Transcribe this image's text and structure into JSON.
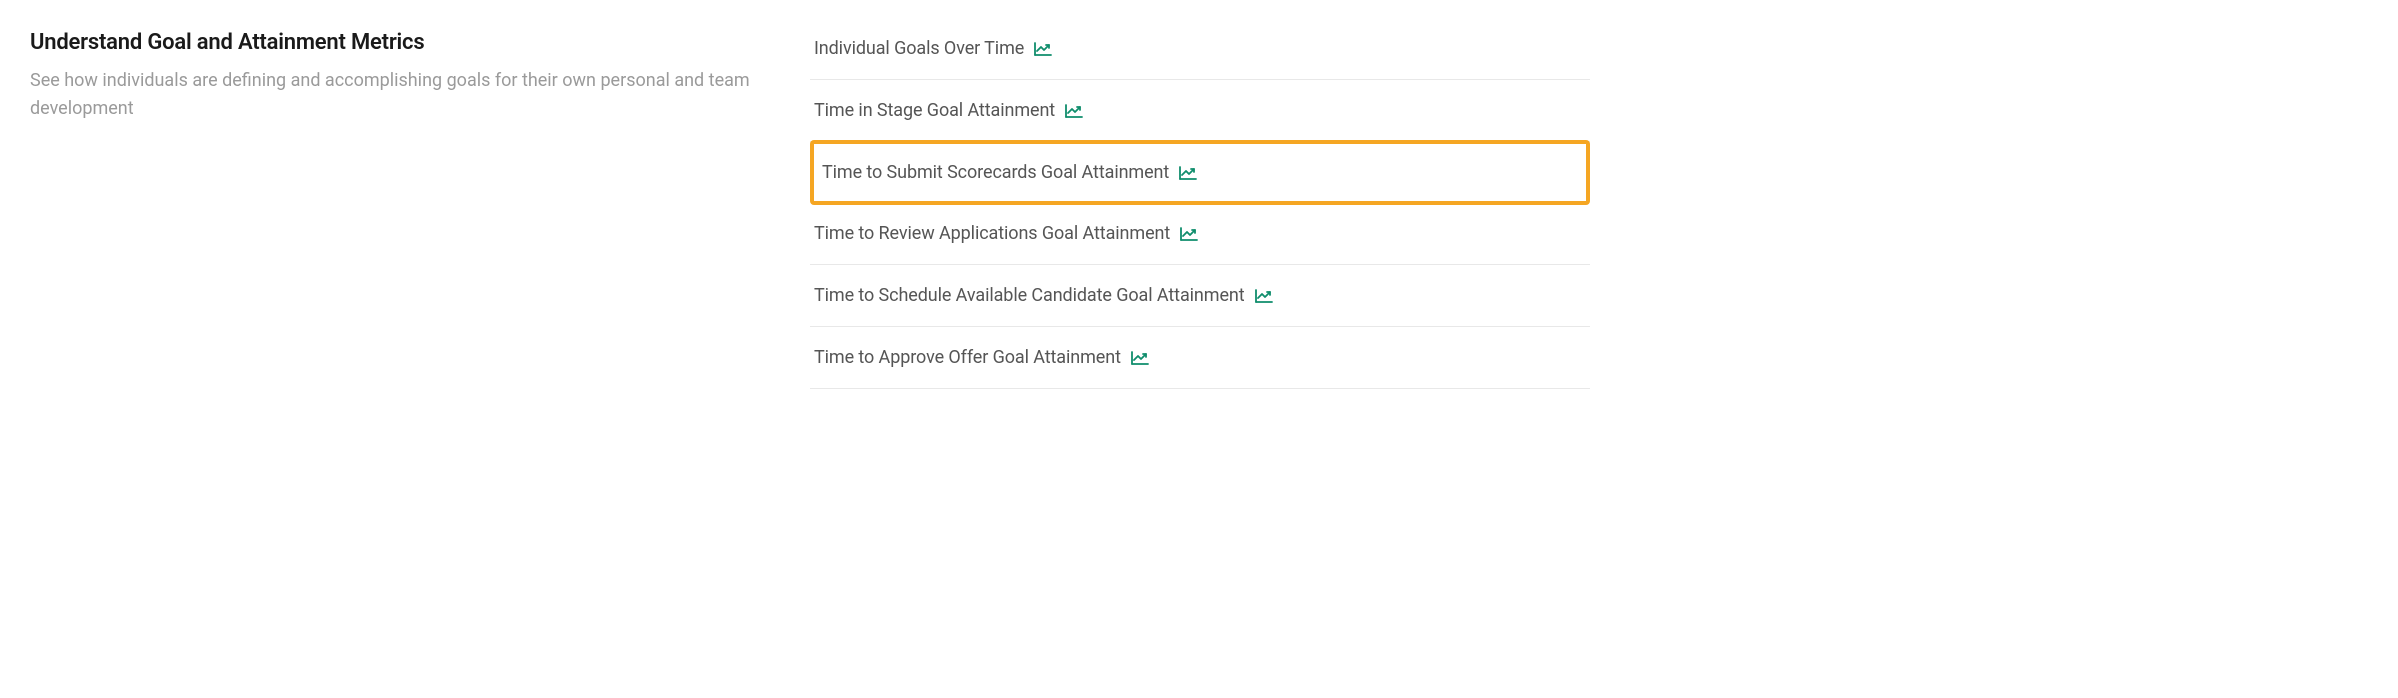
{
  "section": {
    "title": "Understand Goal and Attainment Metrics",
    "description": "See how individuals are defining and accomplishing goals for their own personal and team development"
  },
  "reports": [
    {
      "label": "Individual Goals Over Time",
      "highlighted": false
    },
    {
      "label": "Time in Stage Goal Attainment",
      "highlighted": false
    },
    {
      "label": "Time to Submit Scorecards Goal Attainment",
      "highlighted": true
    },
    {
      "label": "Time to Review Applications Goal Attainment",
      "highlighted": false
    },
    {
      "label": "Time to Schedule Available Candidate Goal Attainment",
      "highlighted": false
    },
    {
      "label": "Time to Approve Offer Goal Attainment",
      "highlighted": false
    }
  ],
  "colors": {
    "icon": "#0f8d6c",
    "highlight": "#f5a623"
  }
}
